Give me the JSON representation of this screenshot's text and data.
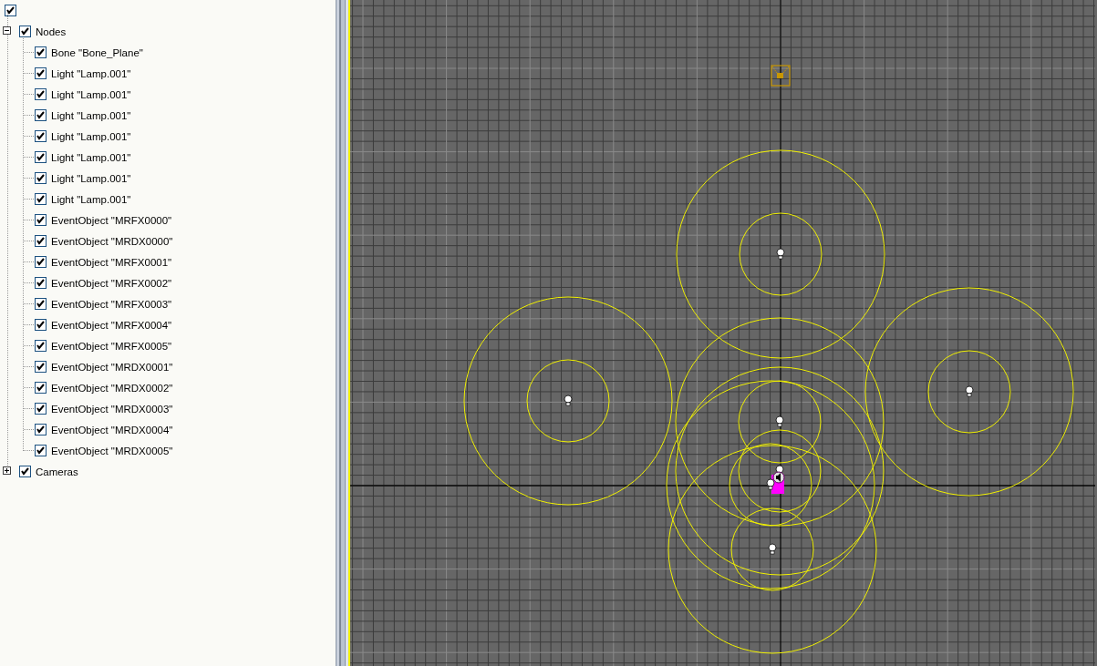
{
  "tree": {
    "root": {
      "checked": true
    },
    "nodes": [
      {
        "label": "Nodes",
        "checked": true,
        "expanded": true,
        "children": [
          {
            "label": "Bone \"Bone_Plane\"",
            "checked": true
          },
          {
            "label": "Light \"Lamp.001\"",
            "checked": true
          },
          {
            "label": "Light \"Lamp.001\"",
            "checked": true
          },
          {
            "label": "Light \"Lamp.001\"",
            "checked": true
          },
          {
            "label": "Light \"Lamp.001\"",
            "checked": true
          },
          {
            "label": "Light \"Lamp.001\"",
            "checked": true
          },
          {
            "label": "Light \"Lamp.001\"",
            "checked": true
          },
          {
            "label": "Light \"Lamp.001\"",
            "checked": true
          },
          {
            "label": "EventObject \"MRFX0000\"",
            "checked": true
          },
          {
            "label": "EventObject \"MRDX0000\"",
            "checked": true
          },
          {
            "label": "EventObject \"MRFX0001\"",
            "checked": true
          },
          {
            "label": "EventObject \"MRFX0002\"",
            "checked": true
          },
          {
            "label": "EventObject \"MRFX0003\"",
            "checked": true
          },
          {
            "label": "EventObject \"MRFX0004\"",
            "checked": true
          },
          {
            "label": "EventObject \"MRFX0005\"",
            "checked": true
          },
          {
            "label": "EventObject \"MRDX0001\"",
            "checked": true
          },
          {
            "label": "EventObject \"MRDX0002\"",
            "checked": true
          },
          {
            "label": "EventObject \"MRDX0003\"",
            "checked": true
          },
          {
            "label": "EventObject \"MRDX0004\"",
            "checked": true
          },
          {
            "label": "EventObject \"MRDX0005\"",
            "checked": true
          }
        ]
      },
      {
        "label": "Cameras",
        "checked": true,
        "expanded": false
      }
    ]
  }
}
